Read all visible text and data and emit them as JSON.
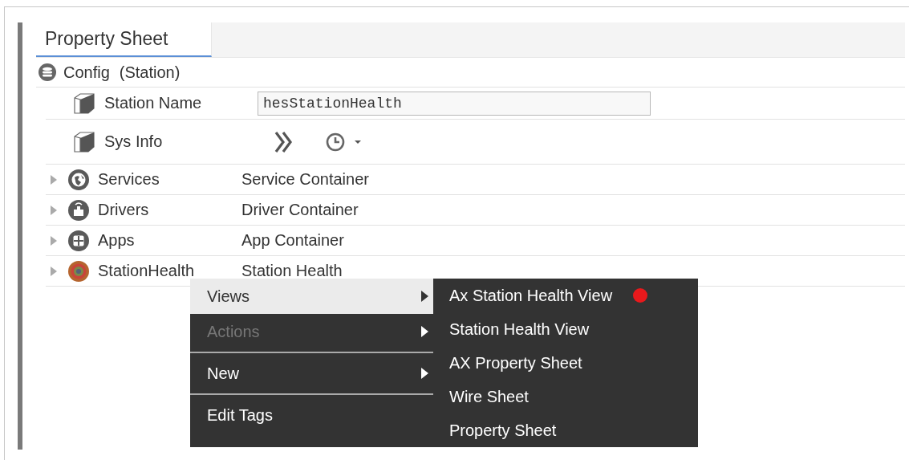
{
  "tabs": [
    {
      "label": "Property Sheet",
      "selected": true
    }
  ],
  "root": {
    "label": "Config",
    "type_label": "(Station)"
  },
  "properties": [
    {
      "kind": "text",
      "label": "Station Name",
      "value": "hesStationHealth"
    },
    {
      "kind": "actions",
      "label": "Sys Info"
    }
  ],
  "components": [
    {
      "label": "Services",
      "type": "Service Container",
      "expanded": false
    },
    {
      "label": "Drivers",
      "type": "Driver Container",
      "expanded": false
    },
    {
      "label": "Apps",
      "type": "App Container",
      "expanded": false
    },
    {
      "label": "StationHealth",
      "type": "Station Health",
      "expanded": false
    }
  ],
  "context_menu": {
    "items": [
      {
        "kind": "item",
        "label": "Views",
        "submenu": true,
        "selected": true,
        "disabled": false
      },
      {
        "kind": "item",
        "label": "Actions",
        "submenu": true,
        "selected": false,
        "disabled": true
      },
      {
        "kind": "separator"
      },
      {
        "kind": "item",
        "label": "New",
        "submenu": true,
        "selected": false,
        "disabled": false
      },
      {
        "kind": "separator"
      },
      {
        "kind": "item",
        "label": "Edit Tags",
        "submenu": false,
        "selected": false,
        "disabled": false
      }
    ],
    "submenu": [
      {
        "label": "Ax Station Health View",
        "marked": true
      },
      {
        "label": "Station Health View",
        "marked": false
      },
      {
        "label": "AX Property Sheet",
        "marked": false
      },
      {
        "label": "Wire Sheet",
        "marked": false
      },
      {
        "label": "Property Sheet",
        "marked": false
      }
    ]
  }
}
